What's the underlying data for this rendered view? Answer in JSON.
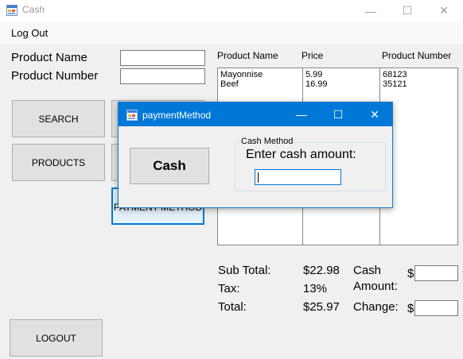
{
  "window": {
    "title": "Cash",
    "icon": "app-form-icon",
    "minimize_glyph": "—",
    "maximize_glyph": "☐",
    "close_glyph": "✕"
  },
  "menu": {
    "logout": "Log Out"
  },
  "form": {
    "product_name_label": "Product Name",
    "product_number_label": "Product Number",
    "product_name_value": "",
    "product_number_value": ""
  },
  "buttons": {
    "search": "SEARCH",
    "products": "PRODUCTS",
    "payment_method": "PAYMENT METHOD",
    "logout": "LOGOUT"
  },
  "list": {
    "headers": [
      "Product Name",
      "Price",
      "Product Number"
    ],
    "names": [
      "Mayonnise",
      "Beef"
    ],
    "prices": [
      "5.99",
      "16.99"
    ],
    "numbers": [
      "68123",
      "35121"
    ]
  },
  "summary": {
    "subtotal_label": "Sub Total:",
    "subtotal_value": "$22.98",
    "tax_label": "Tax:",
    "tax_value": "13%",
    "total_label": "Total:",
    "total_value": "$25.97",
    "cash_label_1": "Cash",
    "cash_label_2": "Amount:",
    "change_label": "Change:",
    "dollar": "$",
    "cash_value": "",
    "change_value": ""
  },
  "dialog": {
    "title": "paymentMethod",
    "cash_button": "Cash",
    "group_title": "Cash Method",
    "prompt": "Enter cash amount:",
    "cash_input_value": ""
  },
  "colors": {
    "accent": "#0078d7",
    "window_bg": "#f0f0f0"
  }
}
